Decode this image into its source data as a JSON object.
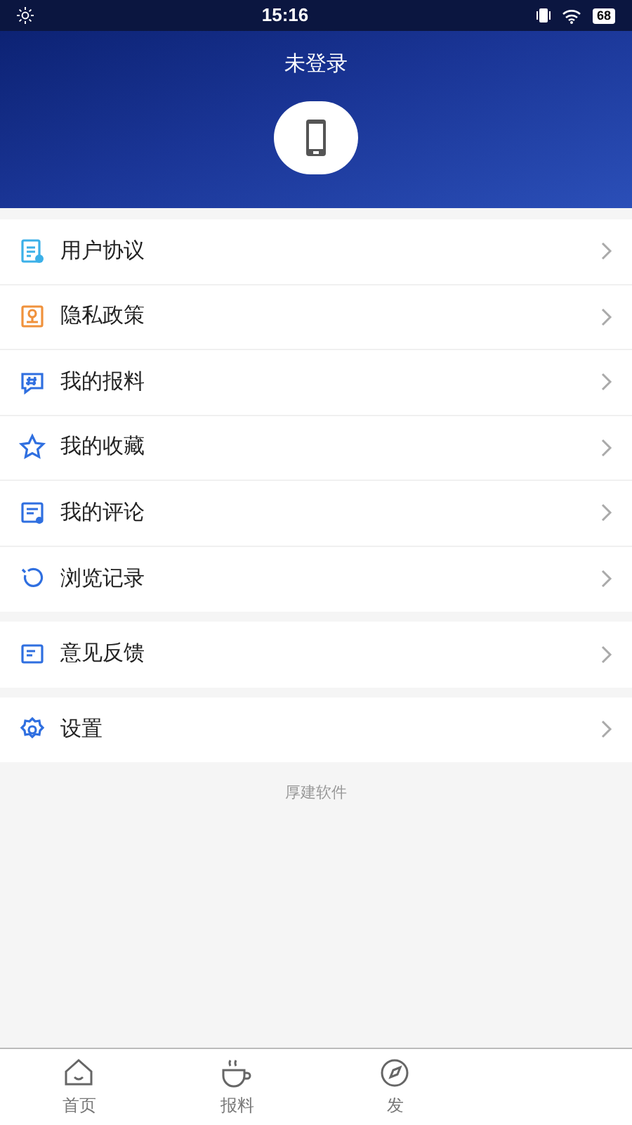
{
  "status_bar": {
    "time": "15:16",
    "battery": "68"
  },
  "header": {
    "title": "未登录"
  },
  "menu_groups": [
    [
      {
        "label": "用户协议"
      },
      {
        "label": "隐私政策"
      },
      {
        "label": "我的报料"
      },
      {
        "label": "我的收藏"
      },
      {
        "label": "我的评论"
      },
      {
        "label": "浏览记录"
      }
    ],
    [
      {
        "label": "意见反馈"
      }
    ],
    [
      {
        "label": "设置"
      }
    ]
  ],
  "footer": "厚建软件",
  "tabs": [
    {
      "label": "首页",
      "selected": false
    },
    {
      "label": "报料",
      "selected": false
    },
    {
      "label": "发",
      "selected": false
    }
  ]
}
